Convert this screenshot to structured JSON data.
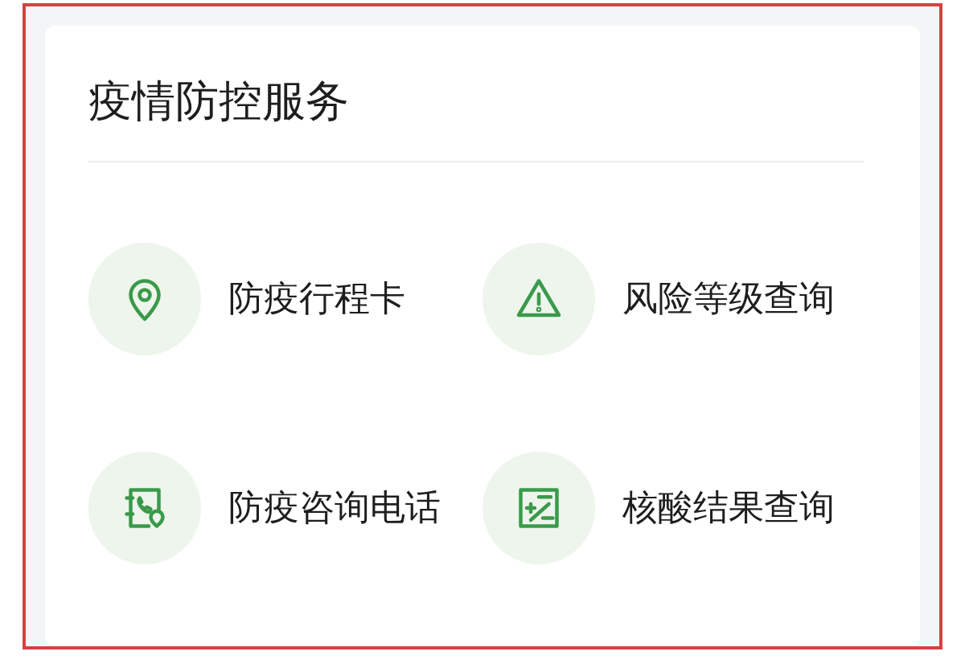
{
  "card": {
    "title": "疫情防控服务",
    "services": [
      {
        "label": "防疫行程卡"
      },
      {
        "label": "风险等级查询"
      },
      {
        "label": "防疫咨询电话"
      },
      {
        "label": "核酸结果查询"
      }
    ]
  }
}
